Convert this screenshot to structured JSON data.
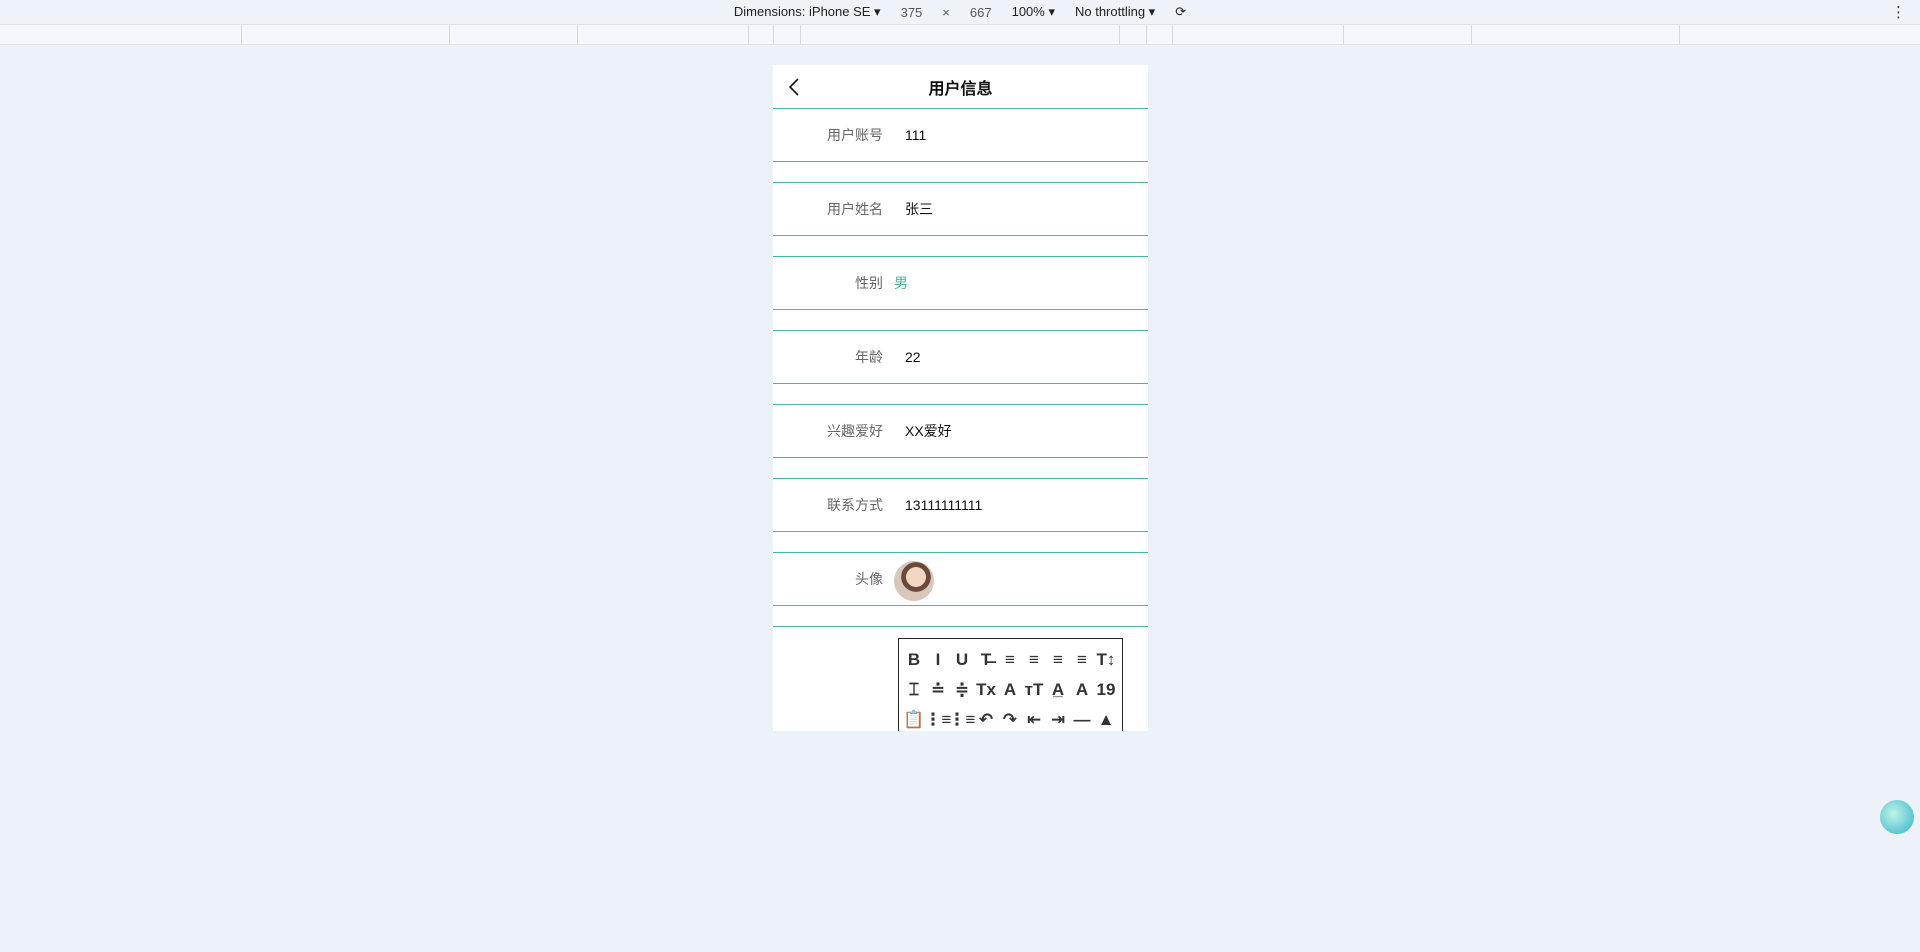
{
  "devtools": {
    "dimensions": "Dimensions: iPhone SE ▾",
    "width": "375",
    "times": "×",
    "height": "667",
    "zoom": "100% ▾",
    "throttling": "No throttling ▾",
    "rotate_icon": "⟳",
    "menu_icon": "⋮"
  },
  "header": {
    "title": "用户信息"
  },
  "fields": [
    {
      "label": "用户账号",
      "value": "111"
    },
    {
      "label": "用户姓名",
      "value": "张三"
    },
    {
      "label": "性别",
      "value": "男"
    },
    {
      "label": "年龄",
      "value": "22"
    },
    {
      "label": "兴趣爱好",
      "value": "XX爱好"
    },
    {
      "label": "联系方式",
      "value": "13111111111"
    },
    {
      "label": "头像"
    }
  ],
  "accent": "#48b99a",
  "toolbar": [
    "B",
    "I",
    "U",
    "T̶",
    "≡",
    "≡",
    "≡",
    "≡",
    "T↕",
    "⌶",
    "≐",
    "≑",
    "Tx",
    "A",
    "тT",
    "A̲",
    "A",
    "19",
    "📋",
    "⋮≡",
    "⋮≡",
    "↶",
    "↷",
    "⇤",
    "⇥",
    "—",
    "▲"
  ]
}
